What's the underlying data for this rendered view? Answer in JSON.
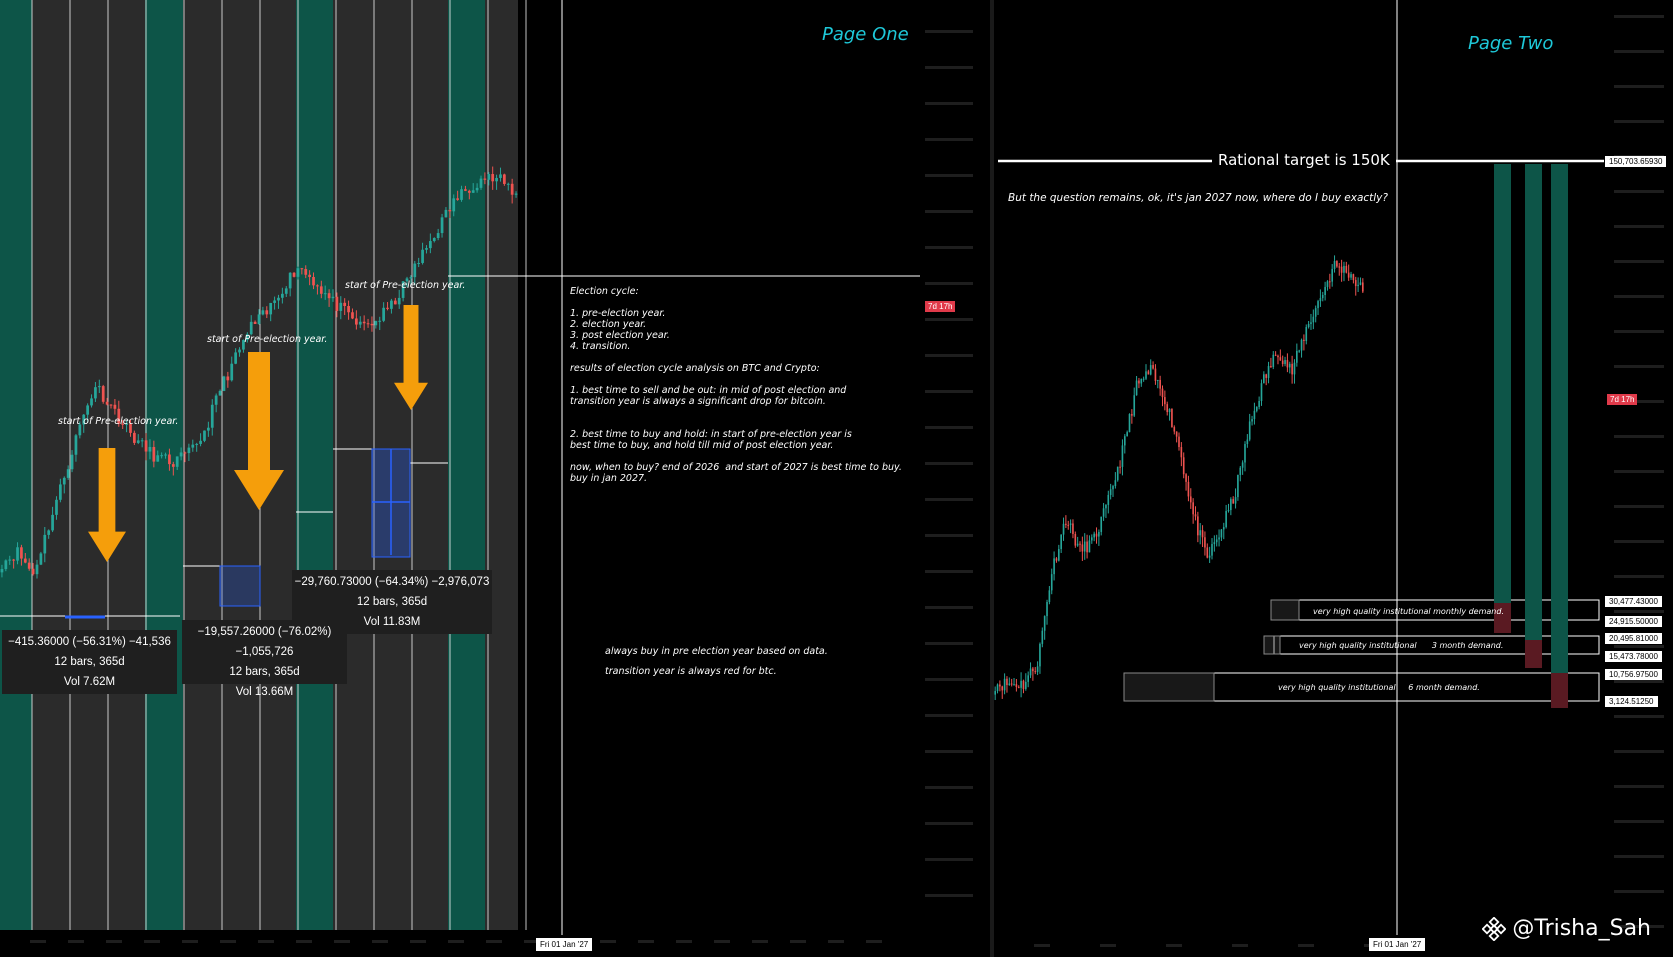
{
  "page_one": {
    "title": "Page One",
    "annotations": {
      "pre_election_1": "start of Pre-election year.",
      "pre_election_2": "start of Pre-election year.",
      "pre_election_3": "start of Pre-election year."
    },
    "measures": [
      {
        "line1": "−415.36000 (−56.31%) −41,536",
        "line2": "12 bars, 365d",
        "line3": "Vol 7.62M"
      },
      {
        "line1": "−19,557.26000 (−76.02%) −1,055,726",
        "line2": "12 bars, 365d",
        "line3": "Vol 13.66M"
      },
      {
        "line1": "−29,760.73000 (−64.34%) −2,976,073",
        "line2": "12 bars, 365d",
        "line3": "Vol 11.83M"
      }
    ],
    "analysis_text": "Election cycle:\n\n1. pre-election year.\n2. election year.\n3. post election year.\n4. transition.\n\nresults of election cycle analysis on BTC and Crypto:\n\n1. best time to sell and be out: in mid of post election and\ntransition year is always a significant drop for bitcoin.\n\n\n2. best time to buy and hold: in start of pre-election year is\nbest time to buy, and hold till mid of post election year.\n\nnow, when to buy? end of 2026  and start of 2027 is best time to buy.\nbuy in jan 2027.",
    "footnote_1": "always buy in pre election year based on data.",
    "footnote_2": "transition year is always red for btc.",
    "countdown_badge": "7d 17h",
    "date_tag": "Fri 01 Jan '27"
  },
  "page_two": {
    "title": "Page Two",
    "target_label": "Rational target is 150K",
    "question": "But the question remains, ok, it's jan 2027 now, where do I buy exactly?",
    "countdown_badge": "7d 17h",
    "date_tag": "Fri 01 Jan '27",
    "price_tags": [
      "150,703.65930",
      "30,477.43000",
      "24,915.50000",
      "20,495.81000",
      "15,473.78000",
      "10,756.97500",
      "3,124.51250"
    ],
    "zones": [
      {
        "label": "very high quality institutional monthly demand."
      },
      {
        "label": "very high quality institutional      3 month demand."
      },
      {
        "label": "very high quality institutional     6 month demand."
      }
    ]
  },
  "watermark": "@Trisha_Sah",
  "colors": {
    "bg": "#000000",
    "pane_gray": "#2b2b2b",
    "band_teal": "#0d5548",
    "up_candle": "#26a69a",
    "down_candle": "#ef5350",
    "arrow_orange": "#f59e0b",
    "title_cyan": "#1ec8d8",
    "measure_blue": "#2962ff"
  },
  "chart_data": [
    {
      "type": "candlestick",
      "title": "Page One",
      "series": [
        {
          "values": [
            1,
            1.1,
            0.9,
            1.4,
            2.2,
            3.5,
            5.1,
            4.2,
            3.4,
            2.9,
            2.6,
            2.5,
            2.7,
            3.3,
            4.9,
            6.5,
            8.7,
            9.8,
            12.4,
            15.1,
            13.3,
            11.2,
            9.9,
            8.7,
            9.1,
            10.5,
            13.2,
            16.8,
            21.5,
            27.3,
            31.5,
            34.2,
            33.1,
            29.4
          ]
        }
      ],
      "annotations": [
        "start of Pre-election year.",
        "start of Pre-election year.",
        "start of Pre-election year."
      ],
      "measurements": [
        "−415.36000 (−56.31%) −41,536",
        "−19,557.26000 (−76.02%) −1,055,726",
        "−29,760.73000 (−64.34%) −2,976,073"
      ]
    },
    {
      "type": "candlestick",
      "title": "Page Two",
      "series": [
        {
          "values": [
            1,
            1,
            1,
            1.2,
            2.6,
            4.1,
            3.1,
            3.4,
            4.7,
            7.2,
            12.5,
            14.3,
            11.4,
            7.6,
            4.2,
            2.9,
            3.7,
            5.1,
            8.9,
            13.3,
            17.1,
            14.2,
            20.4,
            26.7,
            35.1,
            33.2,
            28.1
          ]
        }
      ],
      "levels": [
        150703.6593,
        30477.43,
        24915.5,
        20495.81,
        15473.78,
        10756.975,
        3124.5125
      ],
      "zone_labels": [
        "very high quality institutional monthly demand.",
        "very high quality institutional      3 month demand.",
        "very high quality institutional     6 month demand."
      ],
      "target": "Rational target is 150K"
    }
  ]
}
